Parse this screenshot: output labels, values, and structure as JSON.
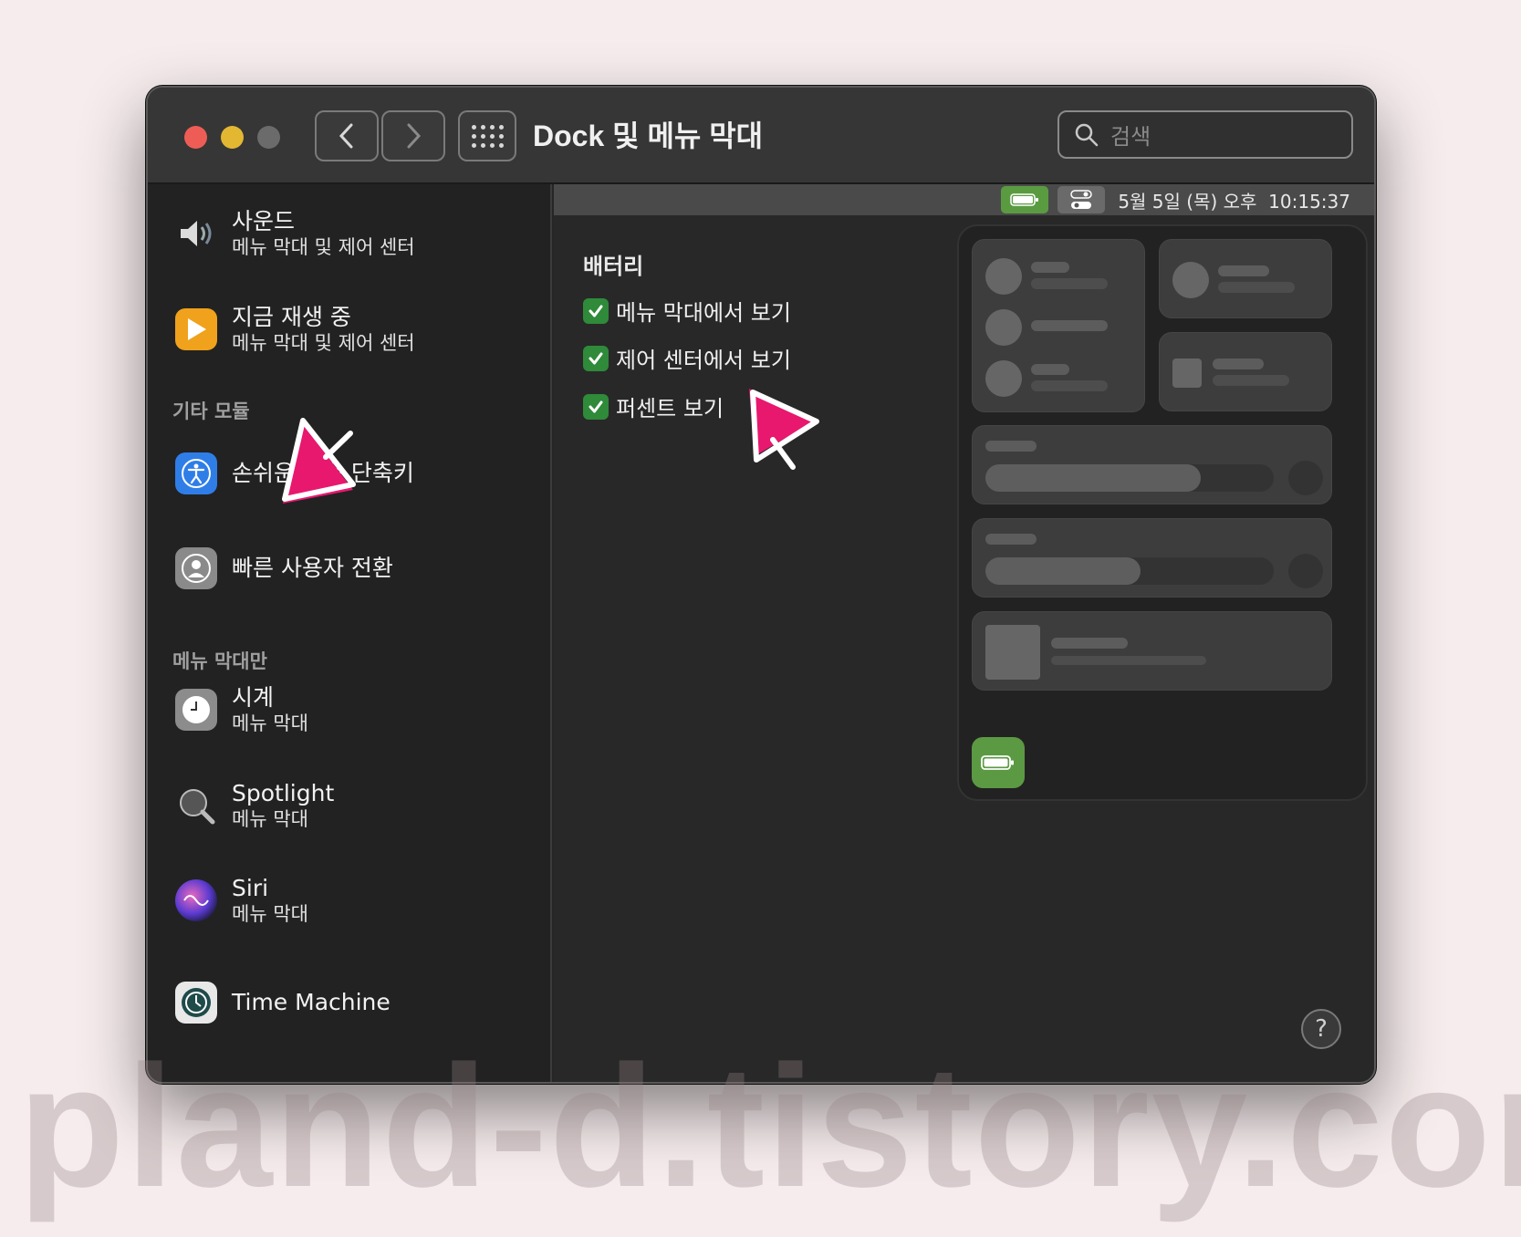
{
  "window": {
    "title": "Dock 및 메뉴 막대",
    "search_placeholder": "검색"
  },
  "sidebar": {
    "items_top": [
      {
        "label": "사운드",
        "sub": "메뉴 막대 및 제어 센터",
        "icon": "speaker-icon"
      },
      {
        "label": "지금 재생 중",
        "sub": "메뉴 막대 및 제어 센터",
        "icon": "play-icon"
      }
    ],
    "section_other": "기타 모듈",
    "items_other": [
      {
        "label": "손쉬운 사용 단축키",
        "icon": "accessibility-icon"
      },
      {
        "label": "빠른 사용자 전환",
        "icon": "user-switch-icon"
      }
    ],
    "section_menubar": "메뉴 막대만",
    "items_menubar": [
      {
        "label": "시계",
        "sub": "메뉴 막대",
        "icon": "clock-icon"
      },
      {
        "label": "Spotlight",
        "sub": "메뉴 막대",
        "icon": "magnifier-icon"
      },
      {
        "label": "Siri",
        "sub": "메뉴 막대",
        "icon": "siri-icon"
      },
      {
        "label": "Time Machine",
        "icon": "time-machine-icon"
      }
    ]
  },
  "menubar_preview": {
    "datetime": "5월 5일 (목) 오후  10:15:37"
  },
  "battery": {
    "title": "배터리",
    "options": [
      {
        "label": "메뉴 막대에서 보기",
        "checked": true
      },
      {
        "label": "제어 센터에서 보기",
        "checked": true
      },
      {
        "label": "퍼센트 보기",
        "checked": true
      }
    ]
  },
  "colors": {
    "accent_check": "#2f8a3a",
    "battery_green": "#5b9a43",
    "annotation_cursor": "#e8186f"
  },
  "watermark": "pland-d.tistory.com",
  "help_label": "?"
}
